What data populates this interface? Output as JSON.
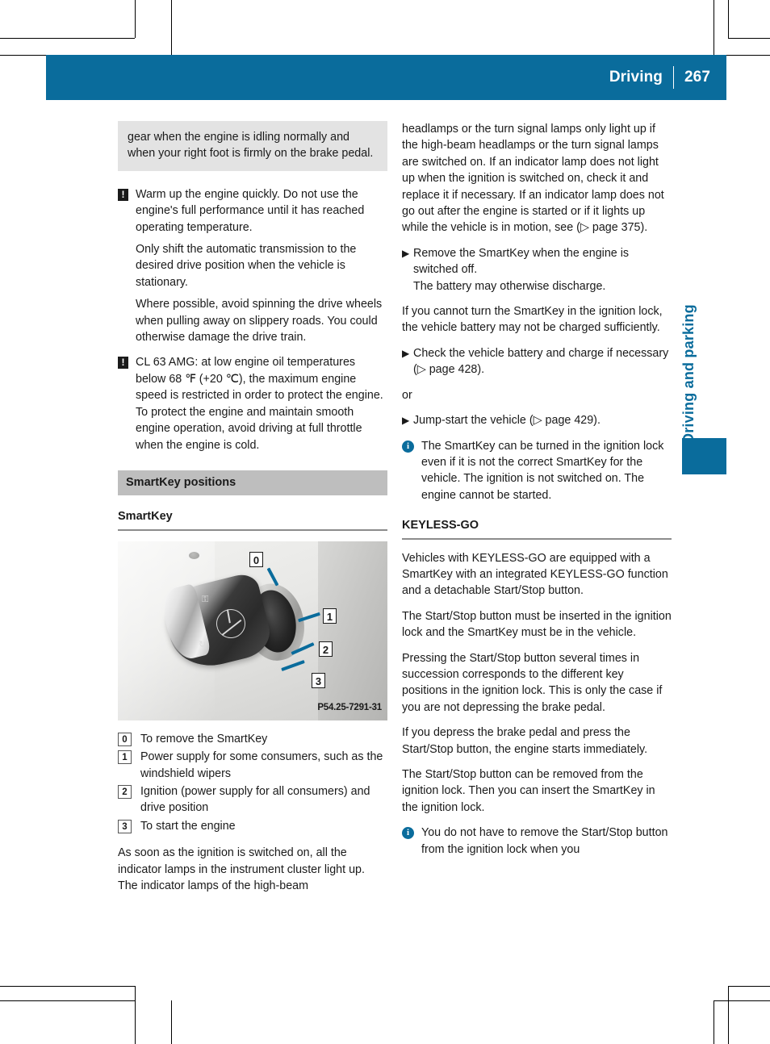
{
  "colors": {
    "brand_blue": "#0a6c9c",
    "band_gray": "#bebebe",
    "note_gray": "#e3e3e3",
    "text": "#1a1a1a"
  },
  "header": {
    "title": "Driving",
    "page_number": "267"
  },
  "side_tab": {
    "label": "Driving and parking"
  },
  "left_column": {
    "note_box": "gear when the engine is idling normally and when your right foot is firmly on the brake pedal.",
    "warning_1": {
      "icon": "warning-icon",
      "paragraphs": [
        "Warm up the engine quickly. Do not use the engine's full performance until it has reached operating temperature.",
        "Only shift the automatic transmission to the desired drive position when the vehicle is stationary.",
        "Where possible, avoid spinning the drive wheels when pulling away on slippery roads. You could otherwise damage the drive train."
      ]
    },
    "warning_2": {
      "icon": "warning-icon",
      "paragraphs": [
        "CL 63 AMG: at low engine oil temperatures below 68 ℉ (+20 ℃), the maximum engine speed is restricted in order to protect the engine. To protect the engine and maintain smooth engine operation, avoid driving at full throttle when the engine is cold."
      ]
    },
    "section_heading": "SmartKey positions",
    "sub_heading": "SmartKey",
    "figure": {
      "caption": "P54.25-7291-31",
      "callouts": [
        "0",
        "1",
        "2",
        "3"
      ],
      "key_marks": [
        "⚿",
        "↻"
      ]
    },
    "legend": [
      {
        "num": "0",
        "text": "To remove the SmartKey"
      },
      {
        "num": "1",
        "text": "Power supply for some consumers, such as the windshield wipers"
      },
      {
        "num": "2",
        "text": "Ignition (power supply for all consumers) and drive position"
      },
      {
        "num": "3",
        "text": "To start the engine"
      }
    ],
    "closing_paragraph": "As soon as the ignition is switched on, all the indicator lamps in the instrument cluster light up. The indicator lamps of the high-beam"
  },
  "right_column": {
    "continued_paragraph": "headlamps or the turn signal lamps only light up if the high-beam headlamps or the turn signal lamps are switched on. If an indicator lamp does not light up when the ignition is switched on, check it and replace it if necessary. If an indicator lamp does not go out after the engine is started or if it lights up while the vehicle is in motion, see (▷ page 375).",
    "action_1": {
      "arrow": "▶",
      "lines": [
        "Remove the SmartKey when the engine is switched off.",
        "The battery may otherwise discharge."
      ]
    },
    "paragraph_battery": "If you cannot turn the SmartKey in the ignition lock, the vehicle battery may not be charged sufficiently.",
    "action_2": {
      "arrow": "▶",
      "lines": [
        "Check the vehicle battery and charge if necessary (▷ page 428)."
      ]
    },
    "or_label": "or",
    "action_3": {
      "arrow": "▶",
      "lines": [
        "Jump-start the vehicle (▷ page 429)."
      ]
    },
    "info_1": {
      "icon": "info-icon",
      "text": "The SmartKey can be turned in the ignition lock even if it is not the correct SmartKey for the vehicle. The ignition is not switched on. The engine cannot be started."
    },
    "keyless_heading": "KEYLESS-GO",
    "keyless_paragraphs": [
      "Vehicles with KEYLESS-GO are equipped with a SmartKey with an integrated KEYLESS-GO function and a detachable Start/Stop button.",
      "The Start/Stop button must be inserted in the ignition lock and the SmartKey must be in the vehicle.",
      "Pressing the Start/Stop button several times in succession corresponds to the different key positions in the ignition lock. This is only the case if you are not depressing the brake pedal.",
      "If you depress the brake pedal and press the Start/Stop button, the engine starts immediately.",
      "The Start/Stop button can be removed from the ignition lock. Then you can insert the SmartKey in the ignition lock."
    ],
    "info_2": {
      "icon": "info-icon",
      "text": "You do not have to remove the Start/Stop button from the ignition lock when you"
    }
  }
}
